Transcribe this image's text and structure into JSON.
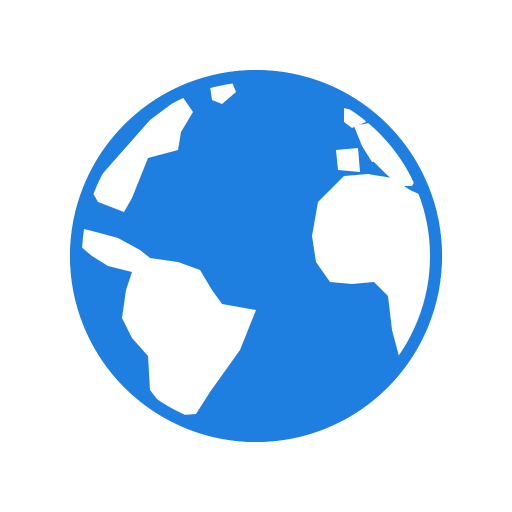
{
  "icon": {
    "name": "globe-icon",
    "colors": {
      "ocean": "#1e7fe0",
      "land": "#ffffff",
      "background": "#ffffff"
    }
  }
}
